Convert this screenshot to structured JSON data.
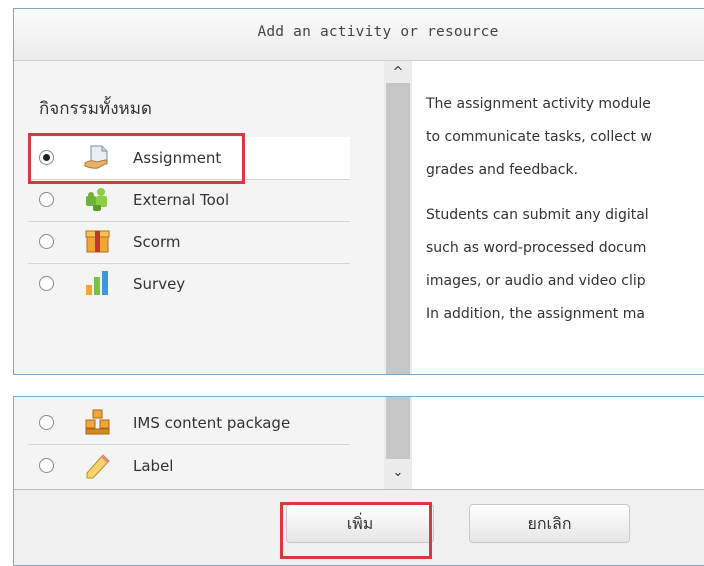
{
  "dialog": {
    "title": "Add an activity or resource"
  },
  "category": {
    "title": "กิจกรรมทั้งหมด"
  },
  "options_top": [
    {
      "label": "Assignment",
      "icon": "assignment-icon",
      "selected": true
    },
    {
      "label": "External Tool",
      "icon": "external-tool-icon",
      "selected": false
    },
    {
      "label": "Scorm",
      "icon": "scorm-icon",
      "selected": false
    },
    {
      "label": "Survey",
      "icon": "survey-icon",
      "selected": false
    }
  ],
  "options_bottom": [
    {
      "label": "IMS content package",
      "icon": "ims-package-icon",
      "selected": false
    },
    {
      "label": "Label",
      "icon": "label-icon",
      "selected": false
    }
  ],
  "description": {
    "lines": [
      "The assignment activity module",
      "to communicate tasks, collect w",
      "grades and feedback.",
      "Students can submit any digital",
      "such as word-processed docum",
      "images, or audio and video clip",
      "In addition, the assignment ma"
    ]
  },
  "buttons": {
    "add": "เพิ่ม",
    "cancel": "ยกเลิก"
  },
  "colors": {
    "highlight": "#d9393e",
    "border": "#7fa7c9"
  }
}
